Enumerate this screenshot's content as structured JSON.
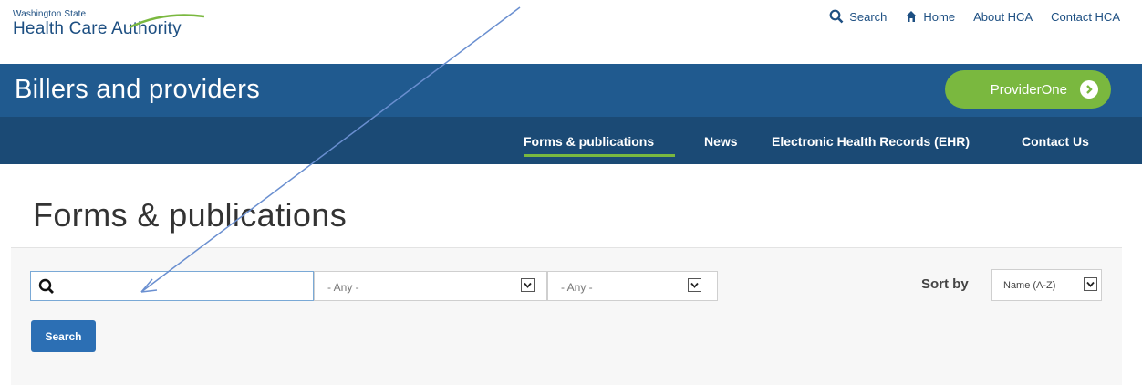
{
  "logo": {
    "line1": "Washington State",
    "line2": "Health Care Authority"
  },
  "utility_nav": {
    "search": "Search",
    "home": "Home",
    "about": "About HCA",
    "contact": "Contact HCA"
  },
  "header": {
    "title": "Billers and providers",
    "provider_one": "ProviderOne"
  },
  "main_nav": {
    "items": [
      "Forms & publications",
      "News",
      "Electronic Health Records (EHR)",
      "Contact Us"
    ],
    "active": "Forms & publications"
  },
  "page": {
    "title": "Forms & publications"
  },
  "filters": {
    "search_value": "",
    "filter1_value": "- Any -",
    "filter2_value": "- Any -",
    "sort_label": "Sort by",
    "sort_value": "Name (A-Z)",
    "search_button": "Search"
  },
  "colors": {
    "header_blue": "#205a8f",
    "nav_blue": "#1b4a75",
    "green": "#7ab83f",
    "button_blue": "#2c6fb4",
    "annotation_arrow": "#6a8fd0"
  },
  "icons": [
    "search-icon",
    "home-icon",
    "arrow-right-circle-icon",
    "chevron-down-icon"
  ]
}
